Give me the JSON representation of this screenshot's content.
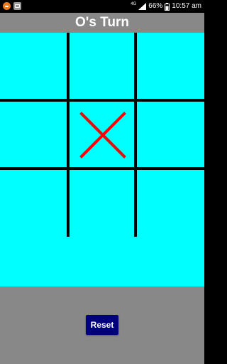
{
  "status_bar": {
    "network_type": "4G",
    "battery_percent": "66%",
    "time": "10:57 am",
    "left_icons": [
      "orange-notification-icon",
      "image-notification-icon"
    ],
    "right_icons": [
      "signal-icon",
      "battery-icon"
    ]
  },
  "header": {
    "title": "O's Turn"
  },
  "board": {
    "rows": 3,
    "cols": 3,
    "cells": [
      "",
      "",
      "",
      "",
      "X",
      "",
      "",
      "",
      ""
    ],
    "x_color": "#ff0000",
    "background_color": "#00ffff",
    "line_color": "#000000"
  },
  "controls": {
    "reset_label": "Reset",
    "reset_color": "#00007f"
  },
  "colors": {
    "background": "#888888",
    "status_bar": "#000000"
  }
}
